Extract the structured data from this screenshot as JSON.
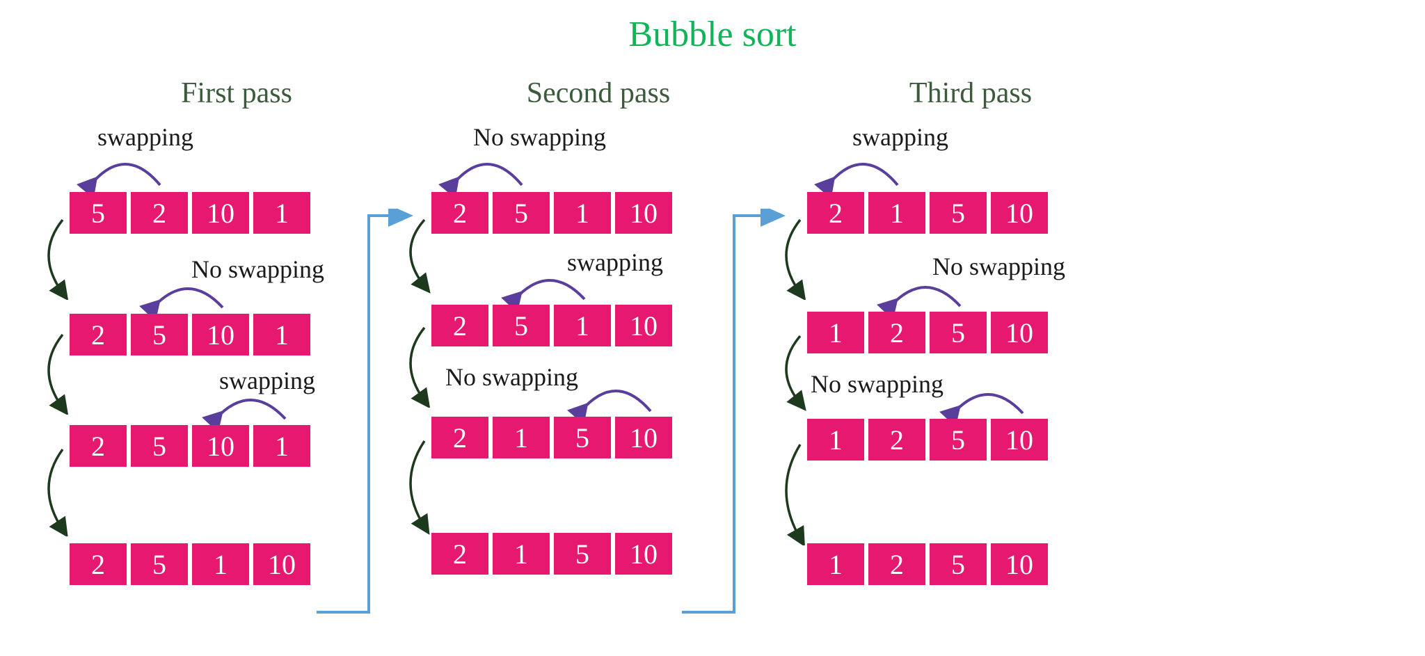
{
  "title": "Bubble sort",
  "passes": [
    {
      "label": "First pass",
      "steps": [
        {
          "swap_text": "swapping",
          "array": [
            "5",
            "2",
            "10",
            "1"
          ]
        },
        {
          "swap_text": "No swapping",
          "array": [
            "2",
            "5",
            "10",
            "1"
          ]
        },
        {
          "swap_text": "swapping",
          "array": [
            "2",
            "5",
            "10",
            "1"
          ]
        },
        {
          "swap_text": "",
          "array": [
            "2",
            "5",
            "1",
            "10"
          ]
        }
      ]
    },
    {
      "label": "Second pass",
      "steps": [
        {
          "swap_text": "No swapping",
          "array": [
            "2",
            "5",
            "1",
            "10"
          ]
        },
        {
          "swap_text": "swapping",
          "array": [
            "2",
            "5",
            "1",
            "10"
          ]
        },
        {
          "swap_text": "No swapping",
          "array": [
            "2",
            "1",
            "5",
            "10"
          ]
        },
        {
          "swap_text": "",
          "array": [
            "2",
            "1",
            "5",
            "10"
          ]
        }
      ]
    },
    {
      "label": "Third pass",
      "steps": [
        {
          "swap_text": "swapping",
          "array": [
            "2",
            "1",
            "5",
            "10"
          ]
        },
        {
          "swap_text": "No swapping",
          "array": [
            "1",
            "2",
            "5",
            "10"
          ]
        },
        {
          "swap_text": "No swapping",
          "array": [
            "1",
            "2",
            "5",
            "10"
          ]
        },
        {
          "swap_text": "",
          "array": [
            "1",
            "2",
            "5",
            "10"
          ]
        }
      ]
    }
  ],
  "colors": {
    "title": "#0fb558",
    "pass_label": "#3c5a3c",
    "cell_bg": "#e6186f",
    "cell_fg": "#ffffff",
    "down_arrow": "#1e3a1e",
    "pass_arrow": "#5a9fd6",
    "swap_arc": "#5a3e9c"
  }
}
